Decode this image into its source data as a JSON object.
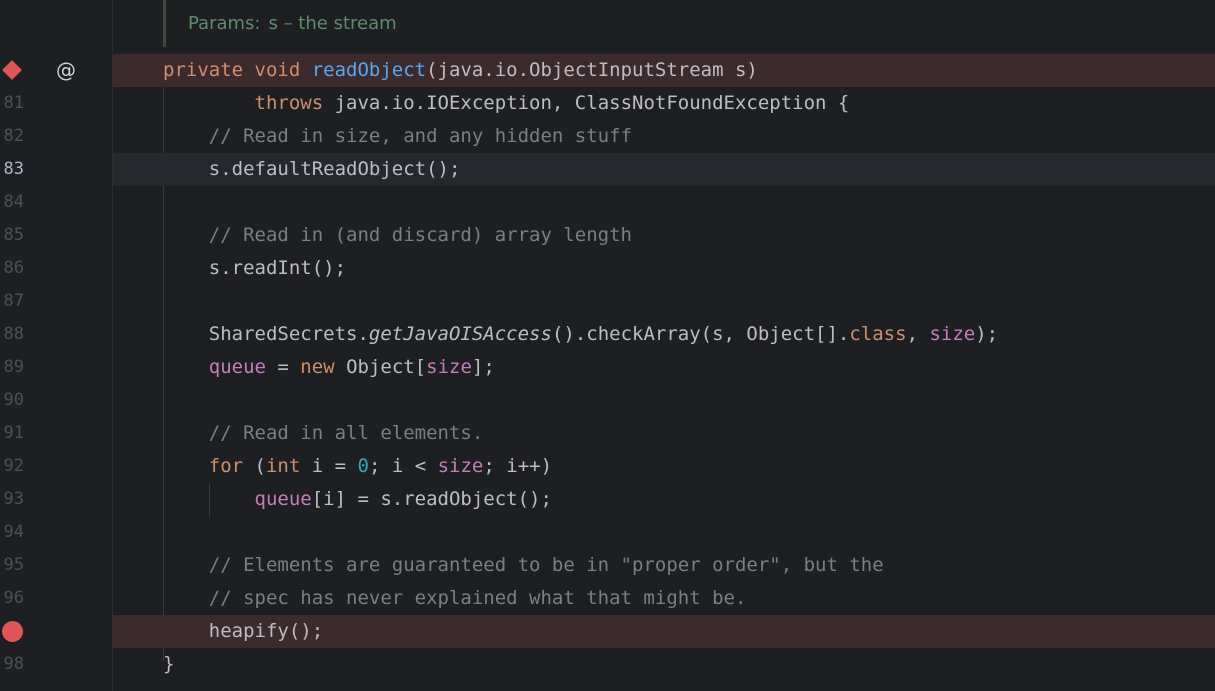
{
  "doc_comment": {
    "label": "Params:",
    "text": "s – the stream"
  },
  "gutter_icons": {
    "breakpoint_method": "diamond-breakpoint-icon",
    "implements": "@",
    "breakpoint_line": "circle-breakpoint-icon"
  },
  "lines": [
    {
      "num": "",
      "tokens": [
        {
          "t": "private void ",
          "c": "kw"
        },
        {
          "t": "readObject",
          "c": "fn"
        },
        {
          "t": "(java.io.ObjectInputStream s)",
          "c": ""
        }
      ]
    },
    {
      "num": "81",
      "tokens": [
        {
          "t": "        throws ",
          "c": "kw"
        },
        {
          "t": "java.io.IOException, ClassNotFoundException {",
          "c": ""
        }
      ]
    },
    {
      "num": "82",
      "tokens": [
        {
          "t": "    // Read in size, and any hidden stuff",
          "c": "cm"
        }
      ]
    },
    {
      "num": "83",
      "tokens": [
        {
          "t": "    s.defaultReadObject();",
          "c": ""
        }
      ]
    },
    {
      "num": "84",
      "tokens": []
    },
    {
      "num": "85",
      "tokens": [
        {
          "t": "    // Read in (and discard) array length",
          "c": "cm"
        }
      ]
    },
    {
      "num": "86",
      "tokens": [
        {
          "t": "    s.readInt();",
          "c": ""
        }
      ]
    },
    {
      "num": "87",
      "tokens": []
    },
    {
      "num": "88",
      "tokens": [
        {
          "t": "    SharedSecrets.",
          "c": ""
        },
        {
          "t": "getJavaOISAccess",
          "c": "it"
        },
        {
          "t": "().checkArray(s, Object[].",
          "c": ""
        },
        {
          "t": "class",
          "c": "kw"
        },
        {
          "t": ", ",
          "c": ""
        },
        {
          "t": "size",
          "c": "fd"
        },
        {
          "t": ");",
          "c": ""
        }
      ]
    },
    {
      "num": "89",
      "tokens": [
        {
          "t": "    ",
          "c": ""
        },
        {
          "t": "queue",
          "c": "fd"
        },
        {
          "t": " = ",
          "c": ""
        },
        {
          "t": "new ",
          "c": "kw"
        },
        {
          "t": "Object[",
          "c": ""
        },
        {
          "t": "size",
          "c": "fd"
        },
        {
          "t": "];",
          "c": ""
        }
      ]
    },
    {
      "num": "90",
      "tokens": []
    },
    {
      "num": "91",
      "tokens": [
        {
          "t": "    // Read in all elements.",
          "c": "cm"
        }
      ]
    },
    {
      "num": "92",
      "tokens": [
        {
          "t": "    ",
          "c": ""
        },
        {
          "t": "for ",
          "c": "kw"
        },
        {
          "t": "(",
          "c": ""
        },
        {
          "t": "int ",
          "c": "kw"
        },
        {
          "t": "i = ",
          "c": ""
        },
        {
          "t": "0",
          "c": "nm"
        },
        {
          "t": "; i < ",
          "c": ""
        },
        {
          "t": "size",
          "c": "fd"
        },
        {
          "t": "; i++)",
          "c": ""
        }
      ]
    },
    {
      "num": "93",
      "tokens": [
        {
          "t": "        ",
          "c": ""
        },
        {
          "t": "queue",
          "c": "fd"
        },
        {
          "t": "[i] = s.readObject();",
          "c": ""
        }
      ]
    },
    {
      "num": "94",
      "tokens": []
    },
    {
      "num": "95",
      "tokens": [
        {
          "t": "    // Elements are guaranteed to be in \"proper order\", but the",
          "c": "cm"
        }
      ]
    },
    {
      "num": "96",
      "tokens": [
        {
          "t": "    // spec has never explained what that might be.",
          "c": "cm"
        }
      ]
    },
    {
      "num": "",
      "tokens": [
        {
          "t": "    heapify();",
          "c": ""
        }
      ]
    },
    {
      "num": "98",
      "tokens": [
        {
          "t": "}",
          "c": ""
        }
      ]
    }
  ]
}
